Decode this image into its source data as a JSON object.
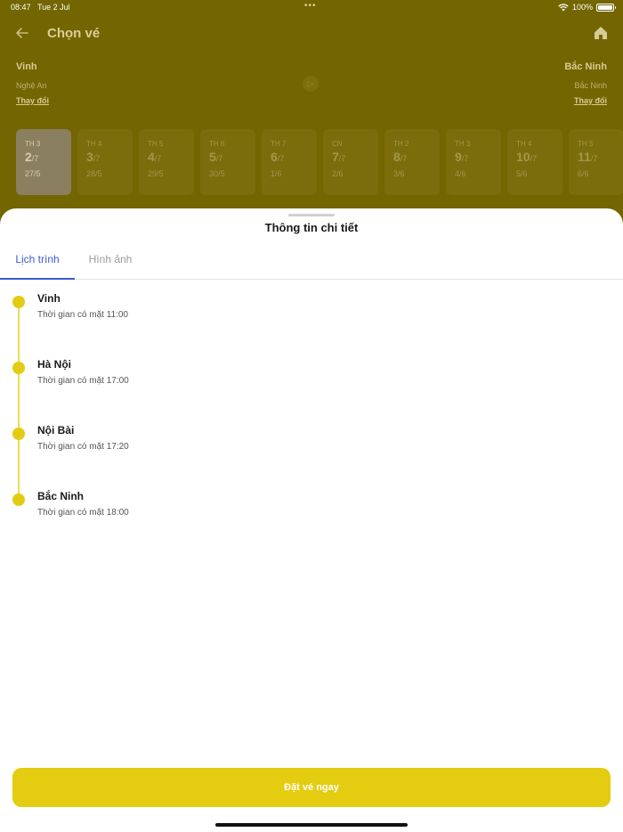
{
  "status_bar": {
    "time": "08:47",
    "date": "Tue 2 Jul",
    "battery": "100%"
  },
  "header": {
    "title": "Chọn vé"
  },
  "route": {
    "from_city": "Vinh",
    "from_province": "Nghệ An",
    "from_change": "Thay đổi",
    "to_city": "Bắc Ninh",
    "to_province": "Bắc Ninh",
    "to_change": "Thay đổi"
  },
  "dates": [
    {
      "dow": "TH 3",
      "day": "2",
      "month": "/7",
      "lunar": "27/5",
      "active": true
    },
    {
      "dow": "TH 4",
      "day": "3",
      "month": "/7",
      "lunar": "28/5"
    },
    {
      "dow": "TH 5",
      "day": "4",
      "month": "/7",
      "lunar": "29/5"
    },
    {
      "dow": "TH 6",
      "day": "5",
      "month": "/7",
      "lunar": "30/5"
    },
    {
      "dow": "TH 7",
      "day": "6",
      "month": "/7",
      "lunar": "1/6"
    },
    {
      "dow": "CN",
      "day": "7",
      "month": "/7",
      "lunar": "2/6"
    },
    {
      "dow": "TH 2",
      "day": "8",
      "month": "/7",
      "lunar": "3/6"
    },
    {
      "dow": "TH 3",
      "day": "9",
      "month": "/7",
      "lunar": "4/6"
    },
    {
      "dow": "TH 4",
      "day": "10",
      "month": "/7",
      "lunar": "5/6"
    },
    {
      "dow": "TH 5",
      "day": "11",
      "month": "/7",
      "lunar": "6/6"
    }
  ],
  "sheet": {
    "title": "Thông tin chi tiết",
    "tabs": {
      "schedule": "Lịch trình",
      "images": "Hình ảnh"
    },
    "stops": [
      {
        "name": "Vinh",
        "time": "Thời gian có mặt 11:00"
      },
      {
        "name": "Hà Nội",
        "time": "Thời gian có mặt 17:00"
      },
      {
        "name": "Nội Bài",
        "time": "Thời gian có mặt 17:20"
      },
      {
        "name": "Bắc Ninh",
        "time": "Thời gian có mặt 18:00"
      }
    ],
    "book_button": "Đặt vé ngay"
  },
  "colors": {
    "accent": "#e4cc10",
    "tab_active": "#3a5bd0",
    "overlay": "#736500"
  }
}
